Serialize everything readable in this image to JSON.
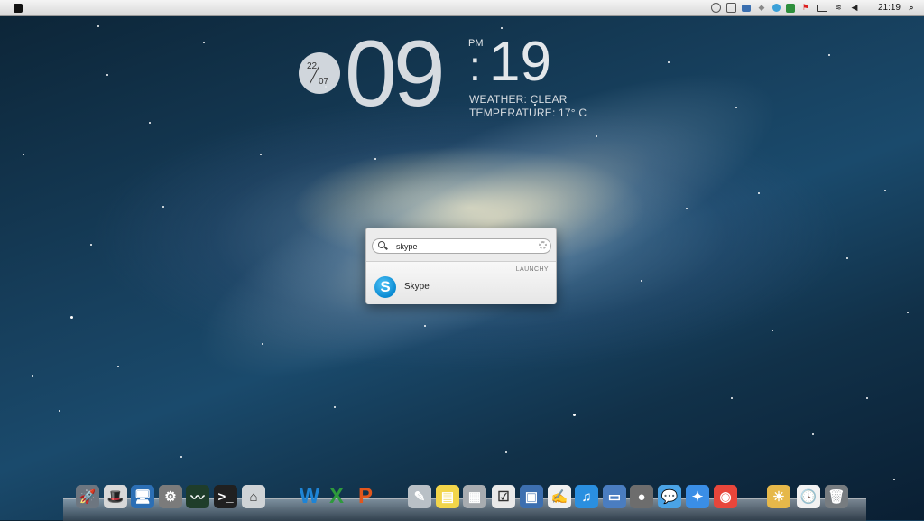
{
  "menubar": {
    "time": "21:19",
    "tray_icons": [
      "clock-icon",
      "notes-icon",
      "mail-icon",
      "droplet-icon",
      "globe-icon",
      "network-icon",
      "flag-icon",
      "battery-icon",
      "wifi-icon",
      "volume-icon"
    ]
  },
  "clock_widget": {
    "day": "22",
    "month": "07",
    "hour": "09",
    "minutes": "19",
    "ampm": "PM",
    "weather": "WEATHER: CLEAR",
    "temperature": "TEMPERATURE: 17° C"
  },
  "launcher": {
    "query": "skype",
    "section_label": "LAUNCHY",
    "result_label": "Skype"
  },
  "dock": {
    "items": [
      {
        "name": "launchpad-icon",
        "color": "#6d7680",
        "glyph": "🚀"
      },
      {
        "name": "alfred-icon",
        "color": "#d8d8d8",
        "glyph": "🎩"
      },
      {
        "name": "display-icon",
        "color": "#2c6fb5",
        "glyph": "🖥"
      },
      {
        "name": "system-preferences-icon",
        "color": "#7b7b7b",
        "glyph": "⚙"
      },
      {
        "name": "activity-monitor-icon",
        "color": "#1f3d2a",
        "glyph": "〰"
      },
      {
        "name": "terminal-icon",
        "color": "#202020",
        "glyph": ">_"
      },
      {
        "name": "home-icon",
        "color": "#cfd3d6",
        "glyph": "⌂"
      },
      {
        "name": "word-icon",
        "color": "#1e84d6",
        "glyph": "W"
      },
      {
        "name": "excel-icon",
        "color": "#2e9a3c",
        "glyph": "X"
      },
      {
        "name": "powerpoint-icon",
        "color": "#e2561c",
        "glyph": "P"
      },
      {
        "name": "pen-icon",
        "color": "#b9c0c6",
        "glyph": "✎"
      },
      {
        "name": "stickies-icon",
        "color": "#f2d54a",
        "glyph": "▤"
      },
      {
        "name": "calculator-icon",
        "color": "#a8acb0",
        "glyph": "▦"
      },
      {
        "name": "checklist-icon",
        "color": "#e9e9e9",
        "glyph": "☑"
      },
      {
        "name": "preview-icon",
        "color": "#3d6fb0",
        "glyph": "▣"
      },
      {
        "name": "textedit-icon",
        "color": "#f0f0f0",
        "glyph": "✍"
      },
      {
        "name": "itunes-icon",
        "color": "#2a8fe0",
        "glyph": "♫"
      },
      {
        "name": "photo-icon",
        "color": "#4a7dc0",
        "glyph": "▭"
      },
      {
        "name": "facetime-icon",
        "color": "#6d6d6d",
        "glyph": "●"
      },
      {
        "name": "messages-icon",
        "color": "#4aa3e6",
        "glyph": "💬"
      },
      {
        "name": "safari-icon",
        "color": "#3a8ee6",
        "glyph": "✦"
      },
      {
        "name": "chrome-icon",
        "color": "#e8463b",
        "glyph": "◉"
      },
      {
        "name": "weather-icon",
        "color": "#e6b84a",
        "glyph": "☀"
      },
      {
        "name": "clock-icon",
        "color": "#f2f2f2",
        "glyph": "🕓"
      },
      {
        "name": "trash-icon",
        "color": "#777c80",
        "glyph": "🗑"
      }
    ]
  }
}
